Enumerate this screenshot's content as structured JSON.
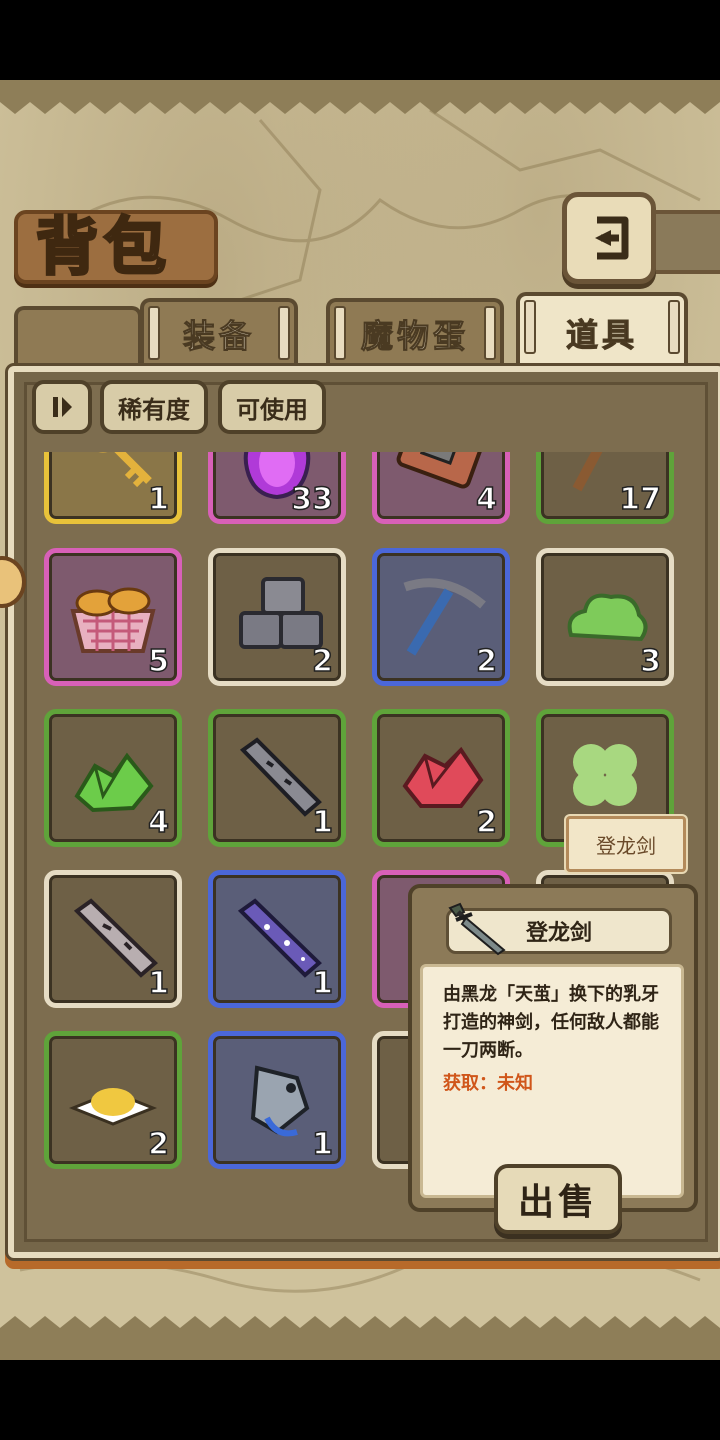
{
  "header": {
    "title": "背包"
  },
  "tabs": [
    {
      "label": "装备",
      "active": false
    },
    {
      "label": "魔物蛋",
      "active": false
    },
    {
      "label": "道具",
      "active": true
    }
  ],
  "filters": {
    "sort_icon": "pause-sort-icon",
    "rarity": "稀有度",
    "usable": "可使用"
  },
  "items": [
    {
      "icon": "golden-key-icon",
      "count": "1",
      "rarity": "yellow"
    },
    {
      "icon": "purple-potion-icon",
      "count": "33",
      "rarity": "pink"
    },
    {
      "icon": "hammer-card-icon",
      "count": "4",
      "rarity": "pink"
    },
    {
      "icon": "pickaxe-icon",
      "count": "17",
      "rarity": "green"
    },
    {
      "icon": "bread-basket-icon",
      "count": "5",
      "rarity": "pink"
    },
    {
      "icon": "stone-blocks-icon",
      "count": "2",
      "rarity": "white"
    },
    {
      "icon": "blue-pickaxe-icon",
      "count": "2",
      "rarity": "blue"
    },
    {
      "icon": "green-slime-icon",
      "count": "3",
      "rarity": "white"
    },
    {
      "icon": "green-crystal-icon",
      "count": "4",
      "rarity": "green"
    },
    {
      "icon": "iron-ingot-icon",
      "count": "1",
      "rarity": "green"
    },
    {
      "icon": "red-crystal-icon",
      "count": "2",
      "rarity": "green"
    },
    {
      "icon": "clover-icon",
      "count": "",
      "rarity": "green"
    },
    {
      "icon": "stone-bar-icon",
      "count": "1",
      "rarity": "white"
    },
    {
      "icon": "star-bar-icon",
      "count": "1",
      "rarity": "blue"
    },
    {
      "icon": "gem-icon",
      "count": "",
      "rarity": "pink"
    },
    {
      "icon": "unknown-item-icon",
      "count": "",
      "rarity": "white"
    },
    {
      "icon": "gold-dust-icon",
      "count": "2",
      "rarity": "green"
    },
    {
      "icon": "fish-fang-icon",
      "count": "1",
      "rarity": "blue"
    },
    {
      "icon": "hidden-item-icon",
      "count": "",
      "rarity": "white"
    },
    {
      "icon": "hidden-item-icon",
      "count": "",
      "rarity": "white"
    }
  ],
  "hover_tag": "登龙剑",
  "tooltip": {
    "name": "登龙剑",
    "icon": "dragon-sword-icon",
    "description": "由黑龙「天茧」换下的乳牙打造的神剑，任何敌人都能一刀两断。",
    "source": "获取：未知",
    "sell_label": "出售"
  },
  "colors": {
    "yellow": "#e8c23a",
    "pink": "#d860b8",
    "blue": "#4b67d8",
    "green": "#5fa33a",
    "white": "#e6dcc4",
    "accent_orange": "#d0561a"
  }
}
